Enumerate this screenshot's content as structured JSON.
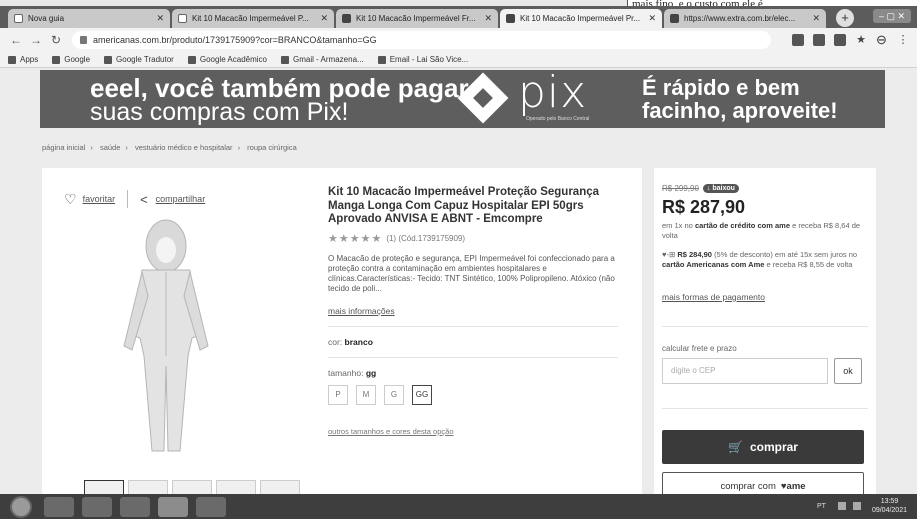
{
  "top_fragment": "mais fino, e o custo com ele é",
  "tabs": [
    {
      "title": "Nova guia",
      "active": false
    },
    {
      "title": "Kit 10 Macacão Impermeável P...",
      "active": false
    },
    {
      "title": "Kit 10 Macacão Impermeável Fr...",
      "active": false
    },
    {
      "title": "Kit 10 Macacão Impermeável Pr...",
      "active": true
    },
    {
      "title": "https://www.extra.com.br/elec...",
      "active": false
    }
  ],
  "address_bar": {
    "url": "americanas.com.br/produto/1739175909?cor=BRANCO&tamanho=GG"
  },
  "bookmarks": [
    "Apps",
    "Google",
    "Google Tradutor",
    "Google Acadêmico",
    "Gmail - Armazena...",
    "Email - Lai São Vice..."
  ],
  "banner": {
    "left_line1": "eeel, você também pode pagar",
    "left_line2": "suas compras com Pix!",
    "pix_word": "pix",
    "pix_sub": "Operado pelo Banco Central",
    "right_line1": "É rápido e bem",
    "right_line2": "facinho, aproveite!"
  },
  "breadcrumb": [
    "página inicial",
    "saúde",
    "vestuário médico e hospitalar",
    "roupa cirúrgica"
  ],
  "product": {
    "favorite_label": "favoritar",
    "share_label": "compartilhar",
    "title": "Kit 10 Macacão Impermeável Proteção Segurança Manga Longa Com Capuz Hospitalar EPI 50grs Aprovado ANVISA E ABNT - Emcompre",
    "rating_stars": "★★★★★",
    "rating_count": "(1)",
    "code": "(Cód.1739175909)",
    "description": "O Macacão de proteção e segurança, EPI Impermeável foi confeccionado para a proteção contra a contaminação em ambientes hospitalares e clínicas.Características:- Tecido: TNT Sintético, 100% Polipropileno. Atóxico (não tecido de poli...",
    "more_info": "mais informações",
    "color_label": "cor:",
    "color_value": "branco",
    "size_label": "tamanho:",
    "size_value": "gg",
    "sizes": [
      "P",
      "M",
      "G",
      "GG"
    ],
    "selected_size": "GG",
    "bottom_note": "outros tamanhos e cores desta opção"
  },
  "buybox": {
    "old_price": "R$ 299,90",
    "badge": "baixou",
    "price": "R$ 287,90",
    "installment": "em 1x no",
    "installment_bold": "cartão de crédito com ame",
    "installment_tail": "e receba R$ 8,64 de volta",
    "pix_icon_text": "♥-⊞",
    "pix_price": "R$ 284,90",
    "pix_discount": "(5% de desconto) em até 15x sem juros no",
    "pix_card": "cartão Americanas com Ame",
    "pix_tail": "e receba R$ 8,55 de volta",
    "payment_link": "mais formas de pagamento",
    "freight_label": "calcular frete e prazo",
    "cep_placeholder": "digite o CEP",
    "ok_label": "ok",
    "buy_label": "comprar",
    "buy_ame_label": "comprar com",
    "ame_brand": "♥ame"
  },
  "taskbar": {
    "lang": "PT",
    "time": "13:59",
    "date": "09/04/2021"
  },
  "colors": {
    "banner": "#5e5e5e",
    "buy_button": "#3a3a3a",
    "taskbar": "#3e3e3e"
  }
}
